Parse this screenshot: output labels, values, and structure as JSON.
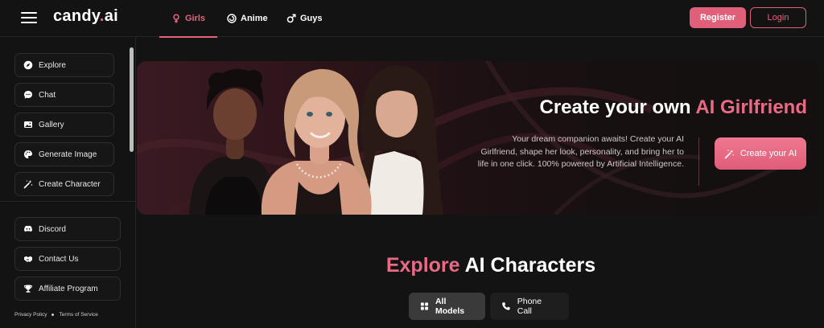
{
  "header": {
    "logo_main": "candy",
    "logo_dot": ".",
    "logo_suffix": "ai",
    "tabs": [
      {
        "label": "Girls",
        "icon": "female-symbol-icon",
        "active": true
      },
      {
        "label": "Anime",
        "icon": "anime-swirl-icon",
        "active": false
      },
      {
        "label": "Guys",
        "icon": "male-symbol-icon",
        "active": false
      }
    ],
    "register_label": "Register",
    "login_label": "Login"
  },
  "sidebar": {
    "primary_items": [
      {
        "label": "Explore",
        "icon": "compass-icon"
      },
      {
        "label": "Chat",
        "icon": "chat-bubble-icon"
      },
      {
        "label": "Gallery",
        "icon": "image-icon"
      },
      {
        "label": "Generate Image",
        "icon": "palette-icon"
      },
      {
        "label": "Create Character",
        "icon": "magic-wand-icon"
      }
    ],
    "secondary_items": [
      {
        "label": "Discord",
        "icon": "discord-icon"
      },
      {
        "label": "Contact Us",
        "icon": "handshake-icon"
      },
      {
        "label": "Affiliate Program",
        "icon": "trophy-icon"
      }
    ],
    "footer": {
      "privacy_label": "Privacy Policy",
      "terms_label": "Terms of Service"
    }
  },
  "hero": {
    "title_prefix": "Create your own ",
    "title_accent": "AI Girlfriend",
    "description": "Your dream companion awaits! Create your AI Girlfriend, shape her look, personality, and bring her to life in one click. 100% powered by Artificial Intelligence.",
    "cta_label": "Create your AI"
  },
  "explore": {
    "title_accent": "Explore",
    "title_rest": " AI Characters",
    "filters": [
      {
        "label": "All Models",
        "icon": "grid-icon",
        "selected": true
      },
      {
        "label": "Phone Call",
        "icon": "phone-icon",
        "selected": false
      }
    ]
  },
  "colors": {
    "accent": "#e8627f",
    "background": "#131313",
    "card_border": "#2e2e2e"
  }
}
